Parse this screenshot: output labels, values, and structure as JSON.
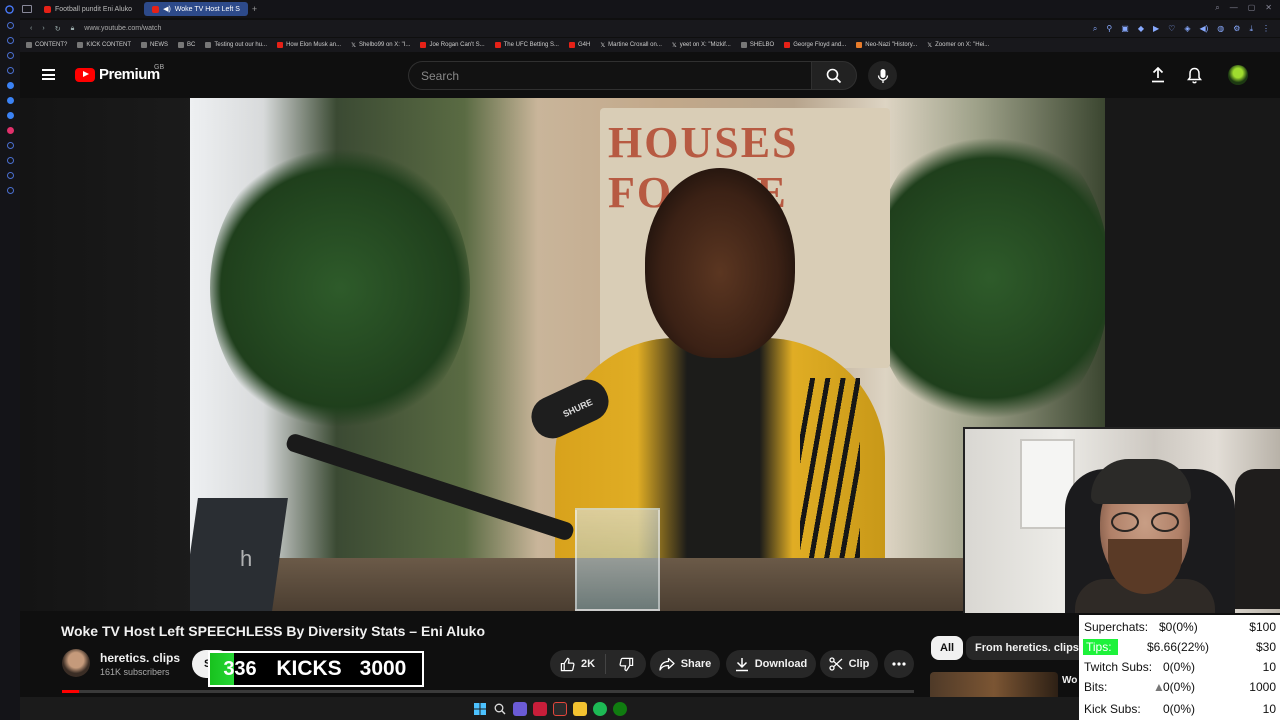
{
  "browser": {
    "tabs": [
      {
        "label": "Football pundit Eni Aluko"
      },
      {
        "label": "Woke TV Host Left S"
      }
    ],
    "new_tab": "+",
    "url": "www.youtube.com/watch",
    "bookmarks": [
      {
        "label": "CONTENT?",
        "icon": "folder-icon"
      },
      {
        "label": "KICK CONTENT",
        "icon": "folder-icon"
      },
      {
        "label": "NEWS",
        "icon": "folder-icon"
      },
      {
        "label": "BC",
        "icon": "folder-icon"
      },
      {
        "label": "Testing out our hu...",
        "icon": "folder-icon"
      },
      {
        "label": "How Elon Musk an...",
        "icon": "youtube-icon"
      },
      {
        "label": "Shelbo99 on X: \"I...",
        "icon": "x-icon"
      },
      {
        "label": "Joe Rogan Can't S...",
        "icon": "youtube-icon"
      },
      {
        "label": "The UFC Betting S...",
        "icon": "youtube-icon"
      },
      {
        "label": "G4H",
        "icon": "youtube-icon"
      },
      {
        "label": "Martine Croxall on...",
        "icon": "x-icon"
      },
      {
        "label": "yeet on X: \"Mizkif...",
        "icon": "x-icon"
      },
      {
        "label": "SHELBO",
        "icon": "folder-icon"
      },
      {
        "label": "George Floyd and...",
        "icon": "youtube-icon"
      },
      {
        "label": "Neo-Nazi \"History...",
        "icon": "globe-icon"
      },
      {
        "label": "Zoomer on X: \"Hei...",
        "icon": "x-icon"
      }
    ]
  },
  "youtube": {
    "logo_text": "Premium",
    "region": "GB",
    "search_placeholder": "Search",
    "video": {
      "title": "Woke TV Host Left SPEECHLESS By Diversity Stats – Eni Aluko",
      "sign_text": "HOUSES\nFO    LE",
      "caption": "h",
      "mic_brand": "SHURE",
      "progress_fraction": 0.02
    },
    "channel": {
      "name": "heretics. clips",
      "subscribers": "161K subscribers",
      "subscribe_label": "S"
    },
    "actions": {
      "likes": "2K",
      "share": "Share",
      "download": "Download",
      "clip": "Clip"
    },
    "chips": {
      "all": "All",
      "from_channel": "From heretics. clips"
    },
    "next_title": "Wo He"
  },
  "overlay": {
    "kicks": {
      "current": "336",
      "label": "KICKS",
      "goal": "3000",
      "fraction": 0.112
    },
    "stats": [
      {
        "label": "Superchats:",
        "value": "$0(0%)",
        "goal": "$100"
      },
      {
        "label": "Tips:",
        "value": "$6.66(22%)",
        "goal": "$30",
        "highlight": true
      },
      {
        "label": "Twitch Subs:",
        "value": "0(0%)",
        "goal": "10"
      },
      {
        "label": "Bits:",
        "value": "0(0%)",
        "goal": "1000"
      },
      {
        "label": "Kick Subs:",
        "value": "0(0%)",
        "goal": "10"
      }
    ]
  },
  "colors": {
    "yt_red": "#ff0000",
    "kicks_green": "#1fc62a",
    "tips_green": "#1df23a",
    "tab_active": "#2d4a8a"
  }
}
